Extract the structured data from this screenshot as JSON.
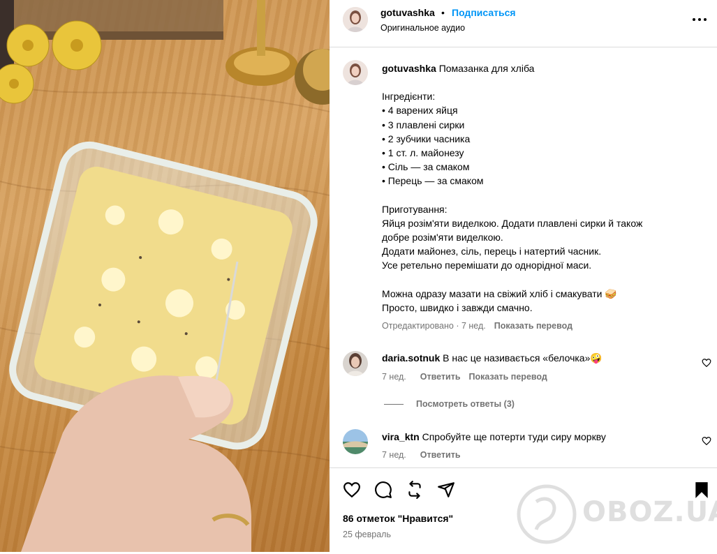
{
  "header": {
    "username": "gotuvashka",
    "dot": "•",
    "follow_label": "Подписаться",
    "audio_label": "Оригинальное аудио",
    "more_icon": "more-horizontal-icon"
  },
  "caption": {
    "username": "gotuvashka",
    "title": "Помазанка для хліба",
    "ingredients_heading": "Інгредієнти:",
    "ingredients": [
      "• 4 варених яйця",
      "• 3 плавлені сирки",
      "• 2 зубчики часника",
      "• 1 ст. л. майонезу",
      "• Сіль — за смаком",
      "• Перець — за смаком"
    ],
    "prep_heading": "Приготування:",
    "prep_lines": [
      "Яйця розім'яти виделкою. Додати плавлені сирки й також",
      "добре розім'яти виделкою.",
      "Додати майонез, сіль, перець і натертий часник.",
      "Усе ретельно перемішати до однорідної маси."
    ],
    "outro_lines": [
      "Можна одразу мазати на свіжий хліб і смакувати 🥪",
      "Просто, швидко і завжди смачно."
    ],
    "edited_label": "Отредактировано · 7 нед.",
    "translate_label": "Показать перевод"
  },
  "comments": [
    {
      "username": "daria.sotnuk",
      "text": "В нас це називається «белочка»🤪",
      "time": "7 нед.",
      "reply_label": "Ответить",
      "translate_label": "Показать перевод",
      "view_replies_label": "Посмотреть ответы (3)"
    },
    {
      "username": "vira_ktn",
      "text": "Спробуйте ще потерти туди сиру моркву",
      "time": "7 нед.",
      "reply_label": "Ответить"
    }
  ],
  "footer": {
    "likes_label": "86 отметок \"Нравится\"",
    "date_label": "25 февраль",
    "watermark_text": "OBOZ.UA"
  },
  "icons": {
    "like": "heart-icon",
    "comment": "comment-icon",
    "repost": "repost-icon",
    "share": "share-icon",
    "save": "bookmark-icon"
  }
}
